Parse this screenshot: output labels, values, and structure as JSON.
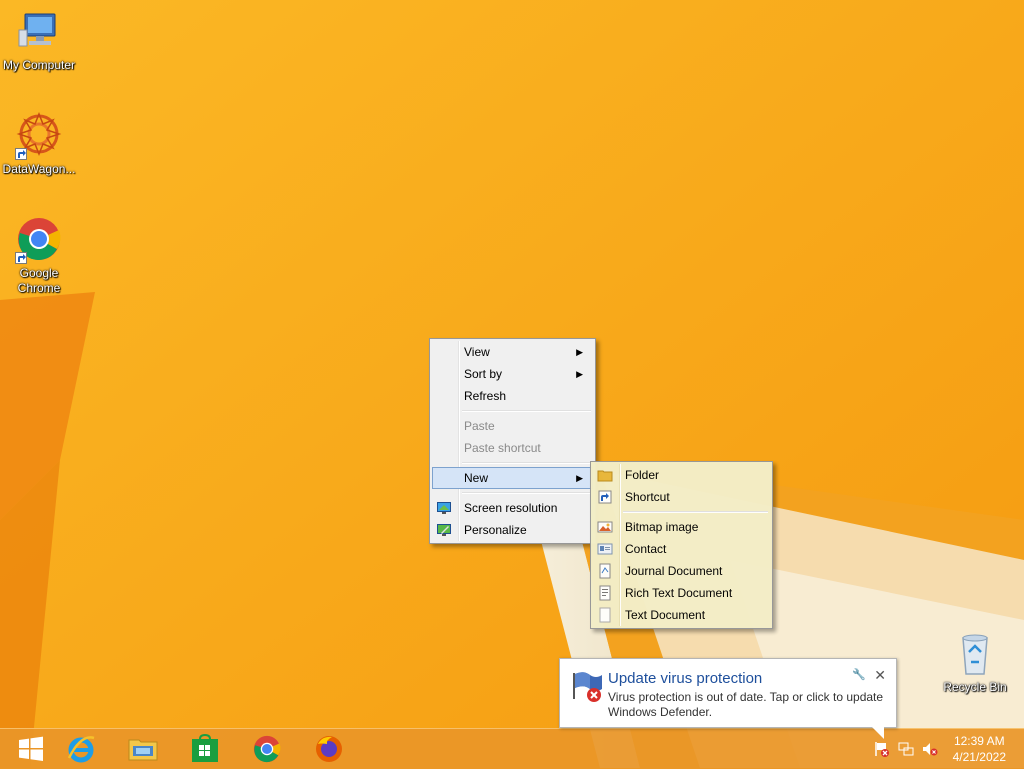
{
  "desktop": {
    "icons": [
      {
        "label": "My Computer",
        "icon": "computer-icon"
      },
      {
        "label": "DataWagon...",
        "icon": "datawagon-icon"
      },
      {
        "label": "Google Chrome",
        "icon": "chrome-icon"
      },
      {
        "label": "Recycle Bin",
        "icon": "recycle-bin-icon"
      }
    ]
  },
  "context_menu": {
    "items": [
      {
        "label": "View",
        "submenu": true
      },
      {
        "label": "Sort by",
        "submenu": true
      },
      {
        "label": "Refresh"
      },
      {
        "label": "Paste",
        "disabled": true
      },
      {
        "label": "Paste shortcut",
        "disabled": true
      },
      {
        "label": "New",
        "submenu": true,
        "highlighted": true
      },
      {
        "label": "Screen resolution",
        "icon": "screen-resolution-icon"
      },
      {
        "label": "Personalize",
        "icon": "personalize-icon"
      }
    ]
  },
  "new_submenu": {
    "items": [
      {
        "label": "Folder",
        "icon": "folder-icon"
      },
      {
        "label": "Shortcut",
        "icon": "shortcut-icon"
      },
      {
        "label": "Bitmap image",
        "icon": "bitmap-icon"
      },
      {
        "label": "Contact",
        "icon": "contact-icon"
      },
      {
        "label": "Journal Document",
        "icon": "journal-icon"
      },
      {
        "label": "Rich Text Document",
        "icon": "rtf-icon"
      },
      {
        "label": "Text Document",
        "icon": "text-document-icon"
      }
    ]
  },
  "notification": {
    "title": "Update virus protection",
    "message": "Virus protection is out of date. Tap or click to update Windows Defender.",
    "icon": "defender-flag-icon"
  },
  "taskbar": {
    "apps": [
      "start-icon",
      "internet-explorer-icon",
      "file-explorer-icon",
      "store-icon",
      "chrome-icon",
      "firefox-icon"
    ],
    "clock": {
      "time": "12:39 AM",
      "date": "4/21/2022"
    }
  },
  "colors": {
    "wallpaper": "#f6a81a",
    "menu_highlight": "#d5e4f7",
    "notification_title": "#1e4f9c"
  }
}
